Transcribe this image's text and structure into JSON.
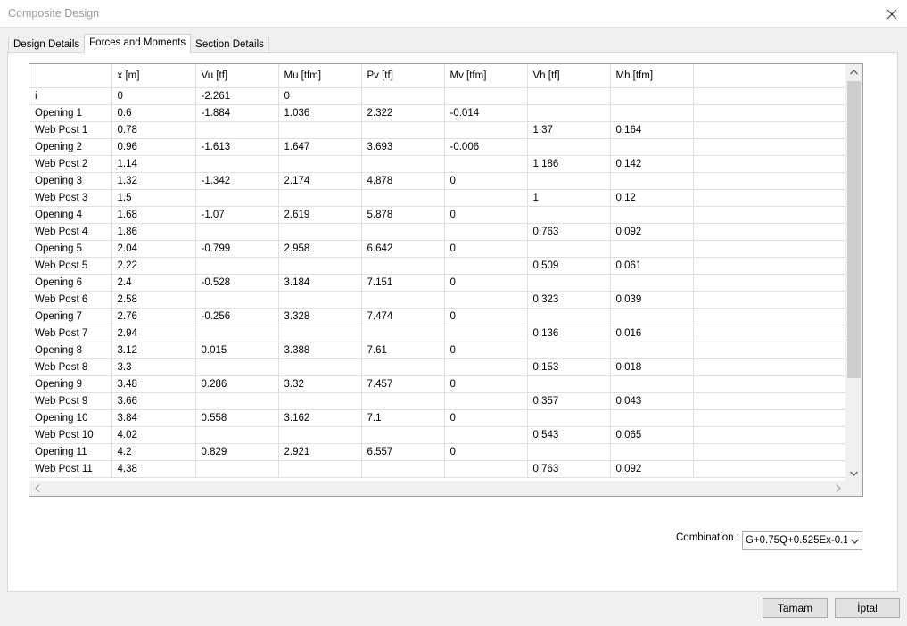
{
  "window": {
    "title": "Composite Design"
  },
  "tabs": [
    {
      "label": "Design Details"
    },
    {
      "label": "Forces and Moments"
    },
    {
      "label": "Section Details"
    }
  ],
  "table": {
    "columns": [
      "",
      "x [m]",
      "Vu [tf]",
      "Mu [tfm]",
      "Pv [tf]",
      "Mv [tfm]",
      "Vh [tf]",
      "Mh [tfm]"
    ],
    "rows": [
      [
        "i",
        "0",
        "-2.261",
        "0",
        "",
        "",
        "",
        ""
      ],
      [
        "Opening 1",
        "0.6",
        "-1.884",
        "1.036",
        "2.322",
        "-0.014",
        "",
        ""
      ],
      [
        "Web Post 1",
        "0.78",
        "",
        "",
        "",
        "",
        "1.37",
        "0.164"
      ],
      [
        "Opening 2",
        "0.96",
        "-1.613",
        "1.647",
        "3.693",
        "-0.006",
        "",
        ""
      ],
      [
        "Web Post 2",
        "1.14",
        "",
        "",
        "",
        "",
        "1.186",
        "0.142"
      ],
      [
        "Opening 3",
        "1.32",
        "-1.342",
        "2.174",
        "4.878",
        "0",
        "",
        ""
      ],
      [
        "Web Post 3",
        "1.5",
        "",
        "",
        "",
        "",
        "1",
        "0.12"
      ],
      [
        "Opening 4",
        "1.68",
        "-1.07",
        "2.619",
        "5.878",
        "0",
        "",
        ""
      ],
      [
        "Web Post 4",
        "1.86",
        "",
        "",
        "",
        "",
        "0.763",
        "0.092"
      ],
      [
        "Opening 5",
        "2.04",
        "-0.799",
        "2.958",
        "6.642",
        "0",
        "",
        ""
      ],
      [
        "Web Post 5",
        "2.22",
        "",
        "",
        "",
        "",
        "0.509",
        "0.061"
      ],
      [
        "Opening 6",
        "2.4",
        "-0.528",
        "3.184",
        "7.151",
        "0",
        "",
        ""
      ],
      [
        "Web Post 6",
        "2.58",
        "",
        "",
        "",
        "",
        "0.323",
        "0.039"
      ],
      [
        "Opening 7",
        "2.76",
        "-0.256",
        "3.328",
        "7.474",
        "0",
        "",
        ""
      ],
      [
        "Web Post 7",
        "2.94",
        "",
        "",
        "",
        "",
        "0.136",
        "0.016"
      ],
      [
        "Opening 8",
        "3.12",
        "0.015",
        "3.388",
        "7.61",
        "0",
        "",
        ""
      ],
      [
        "Web Post 8",
        "3.3",
        "",
        "",
        "",
        "",
        "0.153",
        "0.018"
      ],
      [
        "Opening 9",
        "3.48",
        "0.286",
        "3.32",
        "7.457",
        "0",
        "",
        ""
      ],
      [
        "Web Post 9",
        "3.66",
        "",
        "",
        "",
        "",
        "0.357",
        "0.043"
      ],
      [
        "Opening 10",
        "3.84",
        "0.558",
        "3.162",
        "7.1",
        "0",
        "",
        ""
      ],
      [
        "Web Post 10",
        "4.02",
        "",
        "",
        "",
        "",
        "0.543",
        "0.065"
      ],
      [
        "Opening 11",
        "4.2",
        "0.829",
        "2.921",
        "6.557",
        "0",
        "",
        ""
      ],
      [
        "Web Post 11",
        "4.38",
        "",
        "",
        "",
        "",
        "0.763",
        "0.092"
      ]
    ]
  },
  "combination": {
    "label": "Combination :",
    "value": "G+0.75Q+0.525Ex-0.1"
  },
  "buttons": {
    "ok": "Tamam",
    "cancel": "İptal"
  },
  "icons": {
    "close": "close-icon",
    "scroll_up": "chevron-up-icon",
    "scroll_down": "chevron-down-icon",
    "scroll_left": "chevron-left-icon",
    "scroll_right": "chevron-right-icon",
    "dropdown": "chevron-down-icon"
  }
}
